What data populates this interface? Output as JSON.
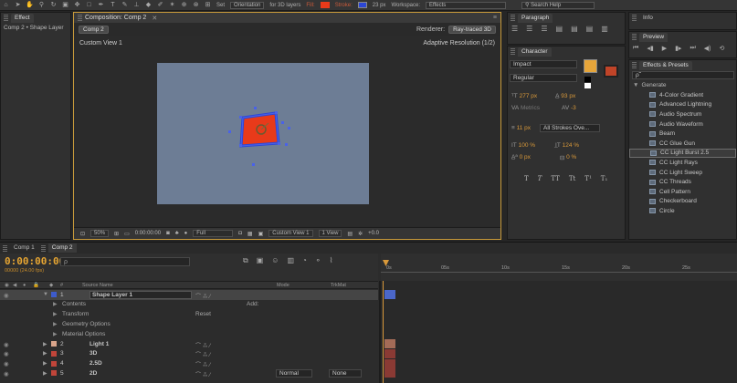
{
  "toolbar": {
    "set_label": "Set",
    "orientation": "Orientation",
    "for3d": "for 3D layers",
    "fill_label": "Fill:",
    "stroke_label": "Stroke:",
    "stroke_px": "23 px",
    "workspace_label": "Workspace:",
    "workspace": "Effects",
    "search_help": "Search Help",
    "fill_color": "#e83a1a",
    "stroke_color": "#2c47d6"
  },
  "project": {
    "tab": "Effect",
    "breadcrumb": "Comp 2 • Shape Layer"
  },
  "comp": {
    "panel_title": "Composition: Comp 2",
    "comp_tab": "Comp 2",
    "renderer": "Renderer:",
    "renderer_value": "Ray-traced 3D",
    "view_name": "Custom View 1",
    "resolution": "Adaptive Resolution (1/2)",
    "footer": {
      "zoom": "50%",
      "timecode": "0:00:00:00",
      "quality": "Full",
      "view": "Custom View 1",
      "views": "1 View",
      "exposure": "+0.0"
    }
  },
  "paragraph": {
    "title": "Paragraph"
  },
  "character": {
    "title": "Character",
    "font": "Impact",
    "style": "Regular",
    "size": "277 px",
    "leading": "93 px",
    "kerning": "Metrics",
    "tracking": "-3",
    "stroke_width": "11 px",
    "stroke_mode": "All Strokes Ove...",
    "vscale": "100 %",
    "hscale": "124 %",
    "baseline": "0 px",
    "tsume": "0 %",
    "styles": [
      "T",
      "T",
      "TT",
      "Tt",
      "T¹",
      "T₁"
    ]
  },
  "info": {
    "title": "Info"
  },
  "preview": {
    "title": "Preview"
  },
  "effects": {
    "title": "Effects & Presets",
    "search_placeholder": "ρ˜",
    "category": "Generate",
    "items": [
      "4-Color Gradient",
      "Advanced Lightning",
      "Audio Spectrum",
      "Audio Waveform",
      "Beam",
      "CC Glue Gun",
      "CC Light Burst 2.5",
      "CC Light Rays",
      "CC Light Sweep",
      "CC Threads",
      "Cell Pattern",
      "Checkerboard",
      "Circle"
    ],
    "selected_index": 6
  },
  "timeline": {
    "tabs": [
      "Comp 1",
      "Comp 2"
    ],
    "active_tab": 1,
    "timecode": "0:00:00:00",
    "fps": "00000 (24.00 fps)",
    "search_placeholder": "ρ",
    "col_source": "Source Name",
    "col_mode": "Mode",
    "col_trkmat": "TrkMat",
    "ruler": [
      "0s",
      "05s",
      "10s",
      "15s",
      "20s",
      "25s"
    ],
    "layers": [
      {
        "num": "1",
        "name": "Shape Layer 1",
        "color": "#3d5bcc",
        "selected": true
      },
      {
        "prop": "Contents",
        "add": "Add:"
      },
      {
        "prop": "Transform",
        "reset": "Reset"
      },
      {
        "prop": "Geometry Options"
      },
      {
        "prop": "Material Options"
      },
      {
        "num": "2",
        "name": "Light 1",
        "color": "#d9a48a"
      },
      {
        "num": "3",
        "name": "3D",
        "color": "#c0453a"
      },
      {
        "num": "4",
        "name": "2.5D",
        "color": "#c0453a"
      },
      {
        "num": "5",
        "name": "2D",
        "color": "#c0453a",
        "mode": "Normal",
        "trkmat": "None"
      }
    ]
  }
}
